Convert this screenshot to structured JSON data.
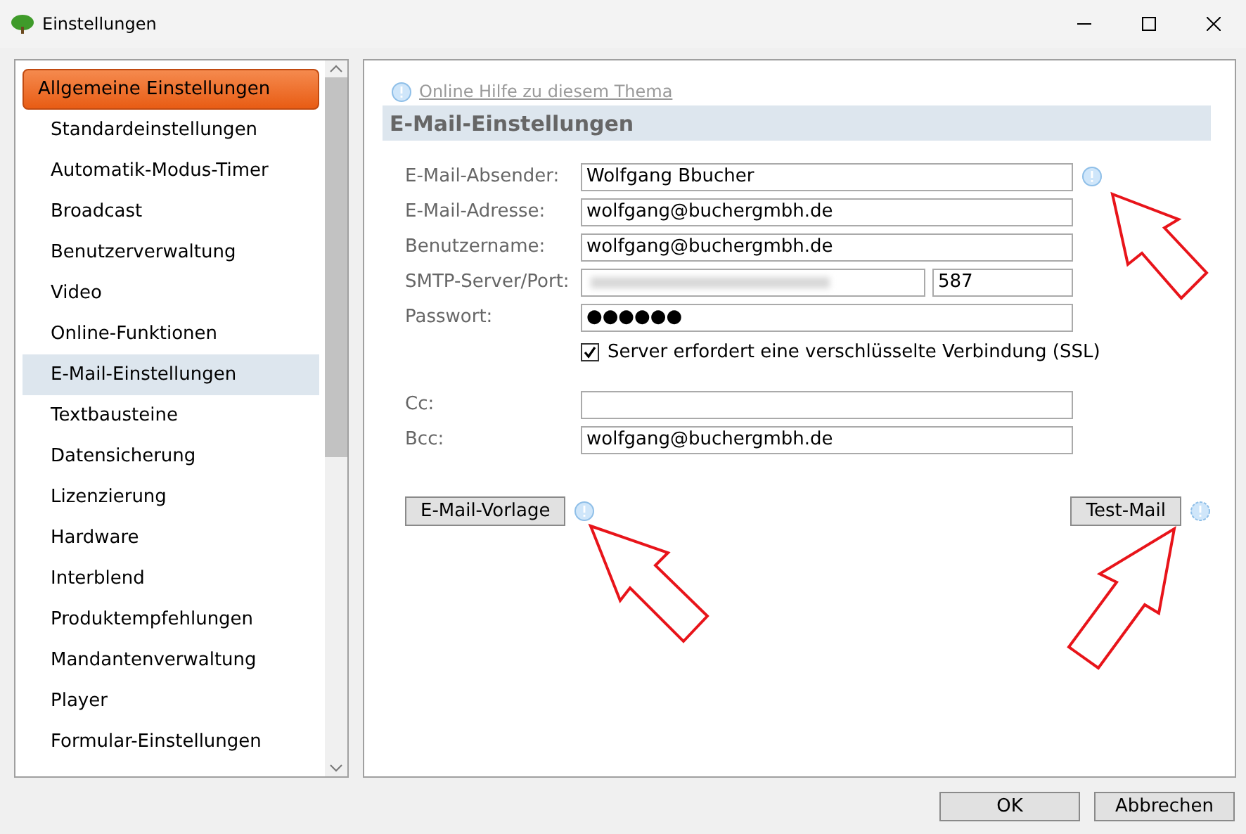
{
  "window": {
    "title": "Einstellungen"
  },
  "sidebar": {
    "items": [
      {
        "label": "Allgemeine Einstellungen",
        "selected": true,
        "highlighted": false
      },
      {
        "label": "Standardeinstellungen",
        "selected": false,
        "highlighted": false
      },
      {
        "label": "Automatik-Modus-Timer",
        "selected": false,
        "highlighted": false
      },
      {
        "label": "Broadcast",
        "selected": false,
        "highlighted": false
      },
      {
        "label": "Benutzerverwaltung",
        "selected": false,
        "highlighted": false
      },
      {
        "label": "Video",
        "selected": false,
        "highlighted": false
      },
      {
        "label": "Online-Funktionen",
        "selected": false,
        "highlighted": false
      },
      {
        "label": "E-Mail-Einstellungen",
        "selected": false,
        "highlighted": true
      },
      {
        "label": "Textbausteine",
        "selected": false,
        "highlighted": false
      },
      {
        "label": "Datensicherung",
        "selected": false,
        "highlighted": false
      },
      {
        "label": "Lizenzierung",
        "selected": false,
        "highlighted": false
      },
      {
        "label": "Hardware",
        "selected": false,
        "highlighted": false
      },
      {
        "label": "Interblend",
        "selected": false,
        "highlighted": false
      },
      {
        "label": "Produktempfehlungen",
        "selected": false,
        "highlighted": false
      },
      {
        "label": "Mandantenverwaltung",
        "selected": false,
        "highlighted": false
      },
      {
        "label": "Player",
        "selected": false,
        "highlighted": false
      },
      {
        "label": "Formular-Einstellungen",
        "selected": false,
        "highlighted": false
      }
    ]
  },
  "help_link": "Online Hilfe zu diesem Thema",
  "section_title": "E-Mail-Einstellungen",
  "form": {
    "sender": {
      "label": "E-Mail-Absender:",
      "value": "Wolfgang Bbucher"
    },
    "address": {
      "label": "E-Mail-Adresse:",
      "value": "wolfgang@buchergmbh.de"
    },
    "username": {
      "label": "Benutzername:",
      "value": "wolfgang@buchergmbh.de"
    },
    "smtp": {
      "label": "SMTP-Server/Port:",
      "port": "587"
    },
    "password": {
      "label": "Passwort:",
      "value": "●●●●●●"
    },
    "ssl": {
      "label": "Server erfordert eine verschlüsselte Verbindung (SSL)",
      "checked": true
    },
    "cc": {
      "label": "Cc:"
    },
    "bcc": {
      "label": "Bcc:",
      "value": "wolfgang@buchergmbh.de"
    }
  },
  "template_button": "E-Mail-Vorlage",
  "test_button": "Test-Mail",
  "buttons": [
    "OK",
    "Abbrechen"
  ]
}
